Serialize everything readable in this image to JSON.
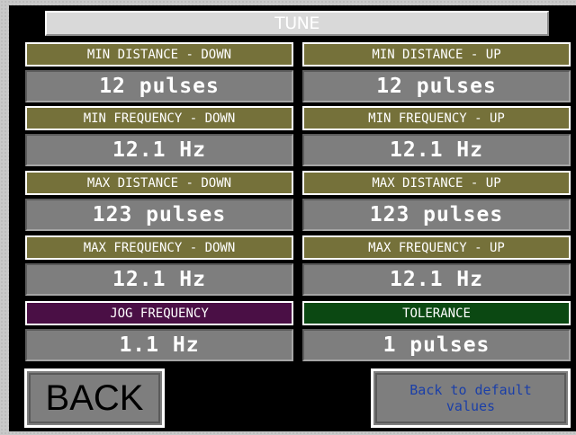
{
  "title": "TUNE",
  "colors": {
    "label_olive": "#75713a",
    "label_purple": "#4a0f45",
    "label_green": "#0b4812",
    "value_gray": "#7e7e7e",
    "default_text": "#1b3fa8"
  },
  "params": {
    "min_distance_down": {
      "label": "MIN DISTANCE - DOWN",
      "value": "12 pulses"
    },
    "min_distance_up": {
      "label": "MIN DISTANCE - UP",
      "value": "12 pulses"
    },
    "min_frequency_down": {
      "label": "MIN FREQUENCY - DOWN",
      "value": "12.1 Hz"
    },
    "min_frequency_up": {
      "label": "MIN FREQUENCY - UP",
      "value": "12.1 Hz"
    },
    "max_distance_down": {
      "label": "MAX DISTANCE - DOWN",
      "value": "123 pulses"
    },
    "max_distance_up": {
      "label": "MAX DISTANCE - UP",
      "value": "123 pulses"
    },
    "max_frequency_down": {
      "label": "MAX FREQUENCY - DOWN",
      "value": "12.1 Hz"
    },
    "max_frequency_up": {
      "label": "MAX FREQUENCY - UP",
      "value": "12.1 Hz"
    },
    "jog_frequency": {
      "label": "JOG FREQUENCY",
      "value": "1.1 Hz"
    },
    "tolerance": {
      "label": "TOLERANCE",
      "value": "1 pulses"
    }
  },
  "buttons": {
    "back": "BACK",
    "default_values": "Back to default values"
  }
}
